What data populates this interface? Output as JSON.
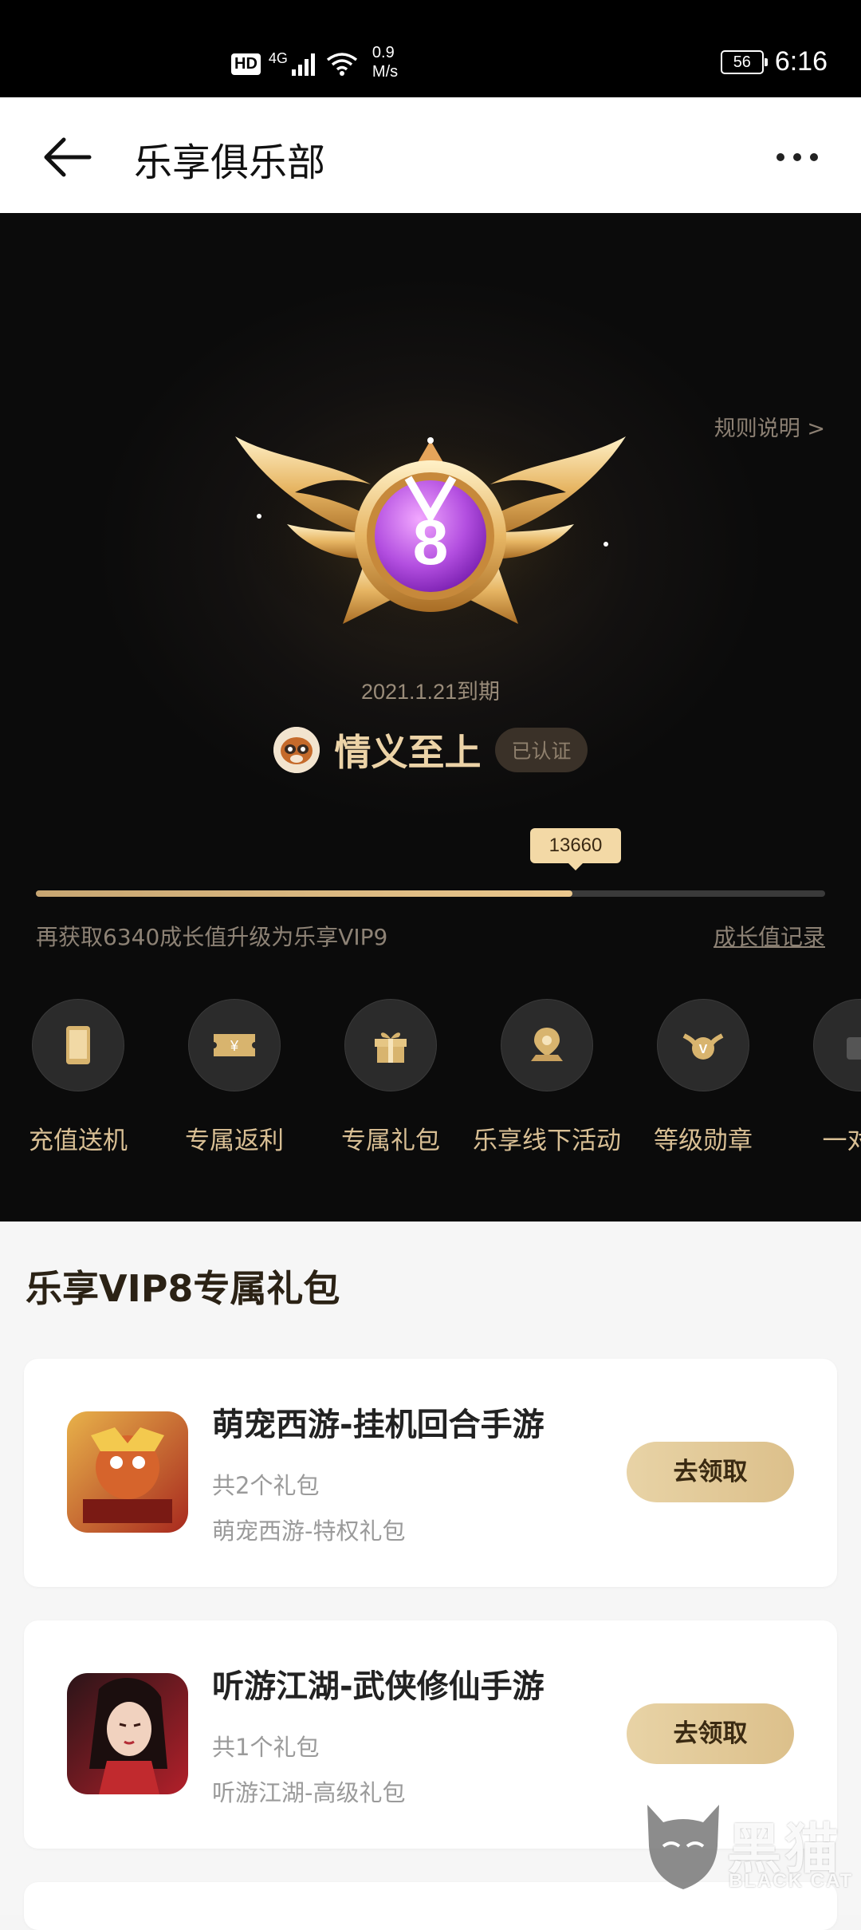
{
  "status_bar": {
    "hd": "HD",
    "network": "4G",
    "speed_value": "0.9",
    "speed_unit": "M/s",
    "battery": "56",
    "time": "6:16"
  },
  "header": {
    "title": "乐享俱乐部",
    "back_icon": "arrow-left-icon",
    "more_icon": "more-dots-icon"
  },
  "vip": {
    "rules_label": "规则说明 >",
    "level": "8",
    "badge_letter": "V",
    "expiry": "2021.1.21到期",
    "username": "情义至上",
    "verified_label": "已认证",
    "growth_value": "13660",
    "progress_fraction": 0.68,
    "upgrade_text": "再获取6340成长值升级为乐享VIP9",
    "growth_record_label": "成长值记录",
    "colors": {
      "accent": "#eac78d",
      "card_bg": "#0b0b0b"
    }
  },
  "benefits": [
    {
      "label": "充值送机",
      "icon": "phone-icon"
    },
    {
      "label": "专属返利",
      "icon": "coupon-icon"
    },
    {
      "label": "专属礼包",
      "icon": "gift-icon"
    },
    {
      "label": "乐享线下活动",
      "icon": "location-pin-icon"
    },
    {
      "label": "等级勋章",
      "icon": "medal-icon"
    },
    {
      "label": "一对一",
      "icon": "bag-icon"
    }
  ],
  "gift_section": {
    "title": "乐享VIP8专属礼包",
    "claim_label": "去领取",
    "items": [
      {
        "title": "萌宠西游-挂机回合手游",
        "count": "共2个礼包",
        "subtitle": "萌宠西游-特权礼包"
      },
      {
        "title": "听游江湖-武侠修仙手游",
        "count": "共1个礼包",
        "subtitle": "听游江湖-高级礼包"
      }
    ]
  },
  "watermark": {
    "text": "黑猫",
    "sub": "BLACK CAT"
  }
}
